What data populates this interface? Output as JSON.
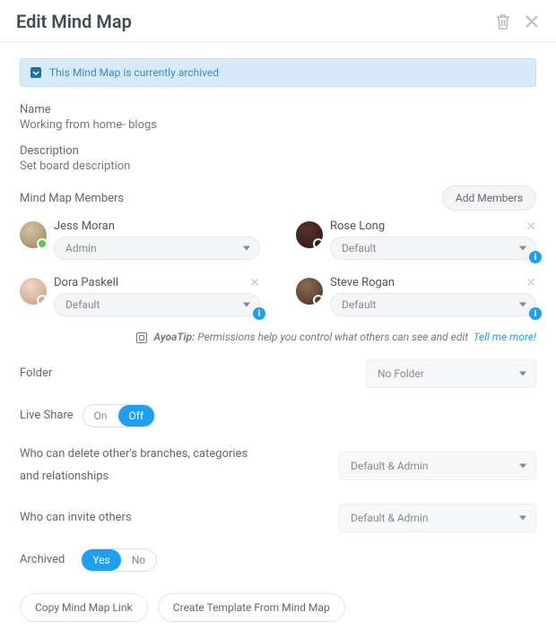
{
  "title": "Edit Mind Map",
  "alert": {
    "text": "This Mind Map is currently archived"
  },
  "name": {
    "label": "Name",
    "value": "Working from home- blogs"
  },
  "description": {
    "label": "Description",
    "placeholder": "Set board description"
  },
  "members": {
    "label": "Mind Map Members",
    "add_button": "Add Members",
    "items": [
      {
        "name": "Jess Moran",
        "role": "Admin",
        "online": true,
        "removable": false
      },
      {
        "name": "Rose Long",
        "role": "Default",
        "online": false,
        "removable": true
      },
      {
        "name": "Dora Paskell",
        "role": "Default",
        "online": false,
        "removable": true
      },
      {
        "name": "Steve Rogan",
        "role": "Default",
        "online": false,
        "removable": true
      }
    ]
  },
  "tip": {
    "label": "AyoaTip:",
    "text": "Permissions help you control what others can see and edit",
    "link": "Tell me more!"
  },
  "folder": {
    "label": "Folder",
    "value": "No Folder"
  },
  "live_share": {
    "label": "Live Share",
    "on": "On",
    "off": "Off",
    "value": "Off"
  },
  "perm_delete": {
    "label": "Who can delete other's branches, categories and relationships",
    "value": "Default & Admin"
  },
  "perm_invite": {
    "label": "Who can invite others",
    "value": "Default & Admin"
  },
  "archived": {
    "label": "Archived",
    "yes": "Yes",
    "no": "No",
    "value": "Yes"
  },
  "footer": {
    "copy_link": "Copy Mind Map Link",
    "create_template": "Create Template From Mind Map"
  }
}
